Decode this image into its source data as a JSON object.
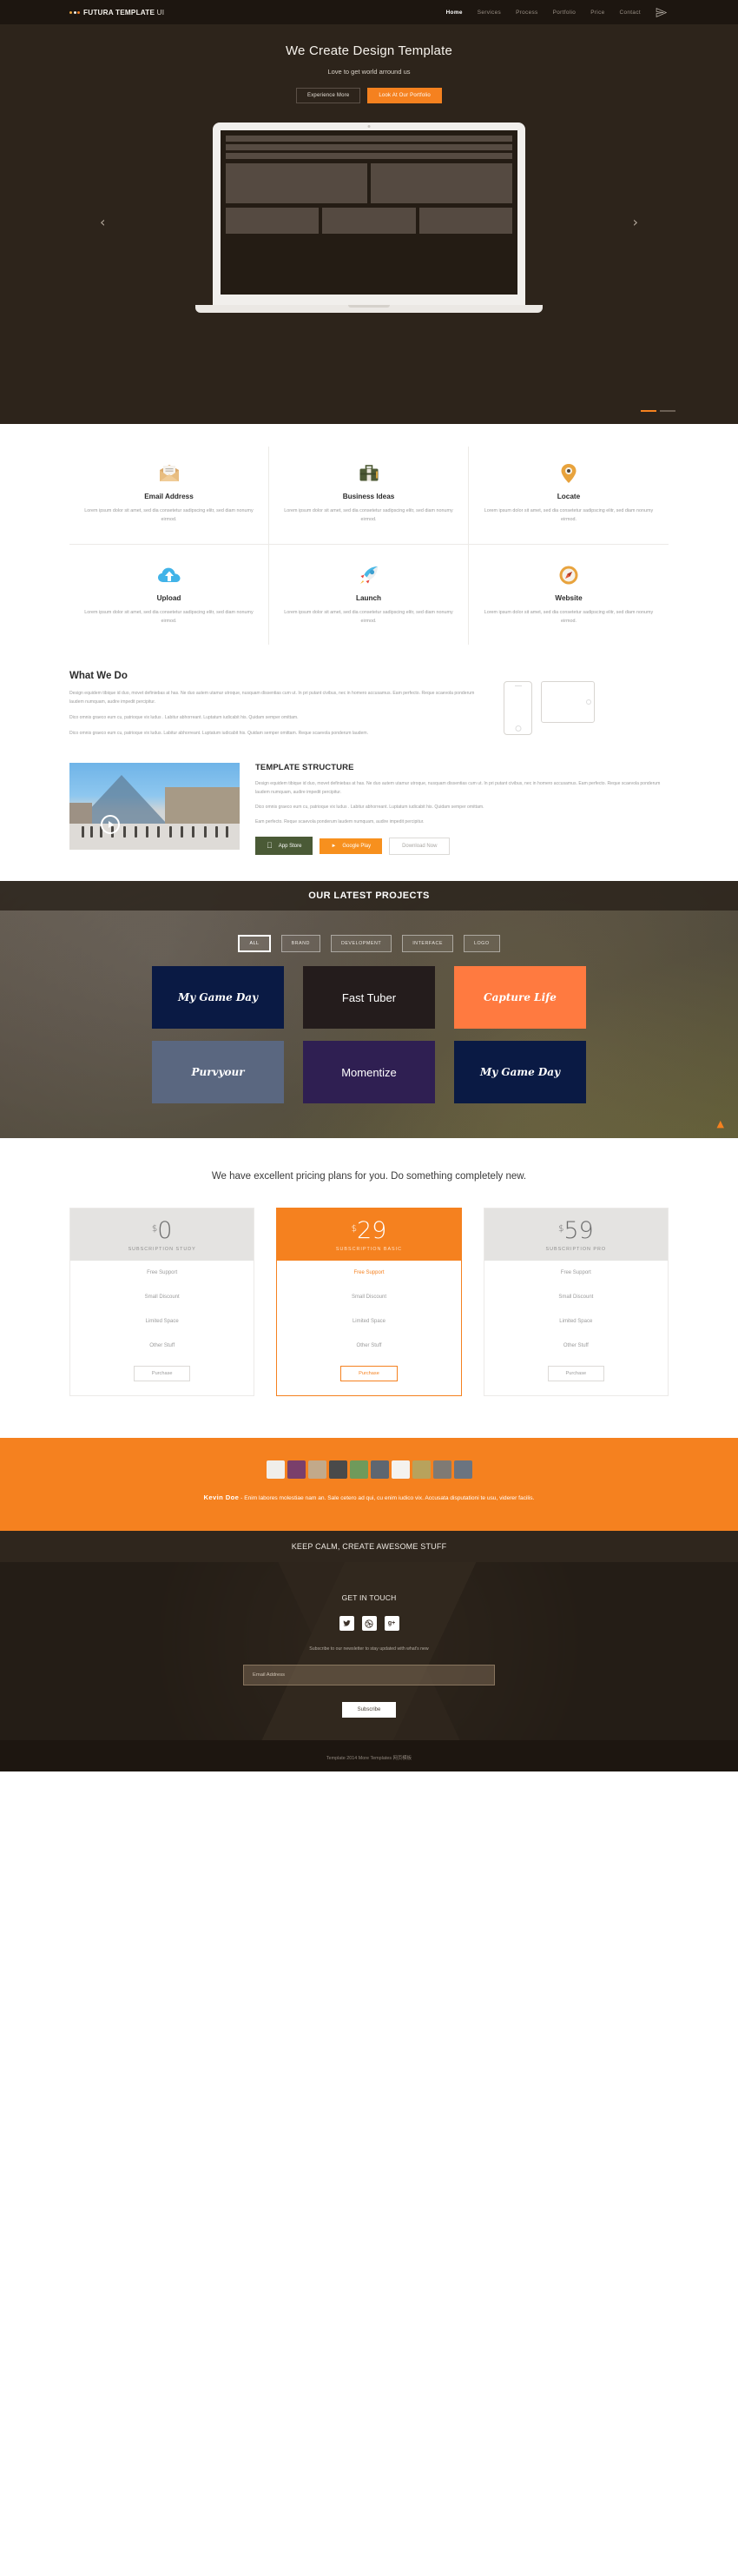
{
  "nav": {
    "brand_main": "FUTURA TEMPLATE",
    "brand_light": " UI",
    "links": [
      {
        "label": "Home",
        "active": true
      },
      {
        "label": "Services",
        "active": false
      },
      {
        "label": "Process",
        "active": false
      },
      {
        "label": "Portfolio",
        "active": false
      },
      {
        "label": "Price",
        "active": false
      },
      {
        "label": "Contact",
        "active": false
      }
    ],
    "plane_icon": "paper-plane-icon"
  },
  "hero": {
    "title": "We Create Design Template",
    "subtitle": "Love to get world arround us",
    "btn_ghost": "Experience More",
    "btn_primary": "Look At Our Portfolio",
    "prev_arrow": "‹",
    "next_arrow": "›",
    "accent_color": "#f5811f",
    "bg_color": "#2d241b"
  },
  "services": [
    {
      "icon": "envelope-icon",
      "title": "Email Address",
      "text": "Lorem ipsum dolor sit amet, sed dia consetetur sadipscing elitr, sed diam nonumy eirmod."
    },
    {
      "icon": "briefcase-icon",
      "title": "Business Ideas",
      "text": "Lorem ipsum dolor sit amet, sed dia consetetur sadipscing elitr, sed diam nonumy eirmod."
    },
    {
      "icon": "location-pin-icon",
      "title": "Locate",
      "text": "Lorem ipsum dolor sit amet, sed dia consetetur sadipscing elitr, sed diam nonumy eirmod."
    },
    {
      "icon": "cloud-upload-icon",
      "title": "Upload",
      "text": "Lorem ipsum dolor sit amet, sed dia consetetur sadipscing elitr, sed diam nonumy eirmod."
    },
    {
      "icon": "rocket-icon",
      "title": "Launch",
      "text": "Lorem ipsum dolor sit amet, sed dia consetetur sadipscing elitr, sed diam nonumy eirmod."
    },
    {
      "icon": "compass-icon",
      "title": "Website",
      "text": "Lorem ipsum dolor sit amet, sed dia consetetur sadipscing elitr, sed diam nonumy eirmod."
    }
  ],
  "whatwedo": {
    "heading": "What We Do",
    "p1": "Design equidem tibique id duo, movet definiebas at has. Ne duo autem utamur utroque, nusquam dissentias cum ut. In pri putant civibus, nec in homero accusamus. Eam perfecto. Reque scaevola ponderum laudem numquam, audire impedit percipitur.",
    "p2": "Dico omnis graeco eum cu, patrioque vix ludus . Labitur abhorreant. Luptatum iudicabit his. Quidam semper omittam.",
    "p3": "Dico omnis graeco eum cu, patrioque vix ludus. Labitur abhorreant. Luptatum iudicabit his. Quidam semper omittam. Reque scaevola ponderum laudem."
  },
  "template_structure": {
    "heading": "TEMPLATE STRUCTURE",
    "p1": "Design equidem tibique id duo, movet definiebas at has. Ne duo autem utamur utroque, nusquam dissentias cum ut. In pri putant civibus, nec in homero accusamus. Eam perfecto. Reque scaevola ponderum laudem numquam, audire impedit percipitur.",
    "p2": "Dico omnis graeco eum cu, patrioque vix ludus . Labitur abhorreant. Luptatum iudicabit his. Quidam semper omittam.",
    "p3": "Eam perfecto. Reque scaevola ponderum laudem numquam, audire impedit percipitur.",
    "apple_label": "App Store",
    "google_label": "Google Play",
    "download_label": "Download Now",
    "video_image_alt": "louvre-pyramid-photo"
  },
  "projects": {
    "heading": "OUR LATEST PROJECTS",
    "filters": [
      {
        "label": "ALL",
        "active": true
      },
      {
        "label": "BRAND",
        "active": false
      },
      {
        "label": "DEVELOPMENT",
        "active": false
      },
      {
        "label": "INTERFACE",
        "active": false
      },
      {
        "label": "LOGO",
        "active": false
      }
    ],
    "tiles": [
      {
        "label": "My Game Day",
        "color": "#0a1a44",
        "script": true
      },
      {
        "label": "Fast Tuber",
        "color": "#241c1c",
        "script": false
      },
      {
        "label": "Capture Life",
        "color": "#ff7a40",
        "script": true
      },
      {
        "label": "Purvyour",
        "color": "#5a6780",
        "script": true
      },
      {
        "label": "Momentize",
        "color": "#2f1f52",
        "script": false
      },
      {
        "label": "My Game Day",
        "color": "#0a1a44",
        "script": true
      }
    ],
    "scroll_top_icon": "chevron-up-icon"
  },
  "pricing": {
    "heading": "We have excellent pricing plans for you. Do something completely new.",
    "currency": "$",
    "plans": [
      {
        "amount": "0",
        "name": "SUBSCRIPTION STUDY",
        "featured": false,
        "features": [
          "Free Support",
          "Small Discount",
          "Limited Space",
          "Other Stuff"
        ],
        "cta": "Purchase"
      },
      {
        "amount": "29",
        "name": "SUBSCRIPTION BASIC",
        "featured": true,
        "features": [
          "Free Support",
          "Small Discount",
          "Limited Space",
          "Other Stuff"
        ],
        "cta": "Purchase"
      },
      {
        "amount": "59",
        "name": "SUBSCRIPTION PRO",
        "featured": false,
        "features": [
          "Free Support",
          "Small Discount",
          "Limited Space",
          "Other Stuff"
        ],
        "cta": "Purchase"
      }
    ]
  },
  "testimonial": {
    "author": "Kevin Doe",
    "separator": "-",
    "quote": "Enim labores molestiae nam an. Sale cetero ad qui, cu enim iudico vix. Accusata disputationi te usu, viderer facilis.",
    "bg_color": "#f5811f",
    "avatar_count": 10
  },
  "footer": {
    "keep_calm": "KEEP CALM, CREATE AWESOME STUFF",
    "get_in_touch": "GET IN TOUCH",
    "socials": [
      {
        "icon": "twitter-icon",
        "glyph": "t"
      },
      {
        "icon": "dribbble-icon",
        "glyph": "●"
      },
      {
        "icon": "google-plus-icon",
        "glyph": "g+"
      }
    ],
    "newsletter_note": "Subscribe to our newsletter to stay updated with what's new",
    "email_placeholder": "Email Address",
    "email_value": "",
    "subscribe_label": "Subscribe",
    "copyright": "Template 2014 More Templates 网页模板"
  }
}
